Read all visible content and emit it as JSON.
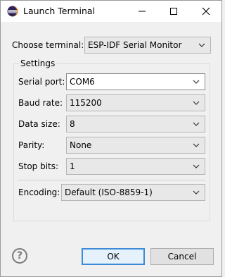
{
  "window": {
    "title": "Launch Terminal",
    "icons": {
      "app": "eclipse-icon",
      "minimize": "minimize-icon",
      "maximize": "maximize-icon",
      "close": "close-icon"
    }
  },
  "terminal": {
    "label": "Choose terminal:",
    "value": "ESP-IDF Serial Monitor"
  },
  "settings": {
    "group_label": "Settings",
    "serial_port": {
      "label": "Serial port:",
      "value": "COM6"
    },
    "baud_rate": {
      "label": "Baud rate:",
      "value": "115200"
    },
    "data_size": {
      "label": "Data size:",
      "value": "8"
    },
    "parity": {
      "label": "Parity:",
      "value": "None"
    },
    "stop_bits": {
      "label": "Stop bits:",
      "value": "1"
    },
    "encoding": {
      "label": "Encoding:",
      "value": "Default (ISO-8859-1)"
    }
  },
  "footer": {
    "help_icon": "help-icon",
    "ok_label": "OK",
    "cancel_label": "Cancel"
  },
  "colors": {
    "default_button_border": "#3c8ad8",
    "background": "#f0f0f0"
  }
}
